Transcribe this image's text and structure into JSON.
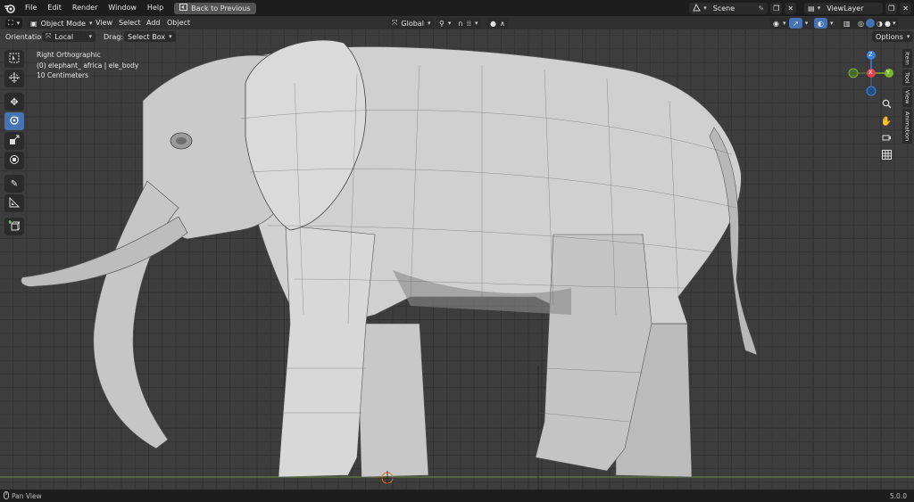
{
  "menu": {
    "items": [
      "File",
      "Edit",
      "Render",
      "Window",
      "Help"
    ],
    "back_button": "Back to Previous"
  },
  "topright": {
    "scene_label": "Scene",
    "viewlayer_label": "ViewLayer"
  },
  "header": {
    "mode_label": "Object Mode",
    "view_menu": "View",
    "select_menu": "Select",
    "add_menu": "Add",
    "object_menu": "Object",
    "transform_orientation": "Global"
  },
  "toolsettings": {
    "orientation_label": "Orientation:",
    "orientation_value": "Local",
    "drag_label": "Drag:",
    "drag_value": "Select Box",
    "options_label": "Options"
  },
  "viewport": {
    "view_name": "Right Orthographic",
    "object_info": "(0) elephant_ africa | ele_body",
    "grid_scale": "10 Centimeters",
    "gizmo_axes": {
      "z": "Z",
      "x": "X",
      "y": "Y"
    },
    "axis_colors": {
      "x": "#e3424e",
      "y": "#78b829",
      "z": "#3b82e0"
    }
  },
  "side_tabs": [
    "Item",
    "Tool",
    "View",
    "Animation"
  ],
  "status": {
    "left_text": "Pan View",
    "version": "5.0.0"
  },
  "colors": {
    "active_tool": "#4772b3",
    "topbar": "#1d1d1d",
    "viewport_bg": "#3d3d3d"
  }
}
